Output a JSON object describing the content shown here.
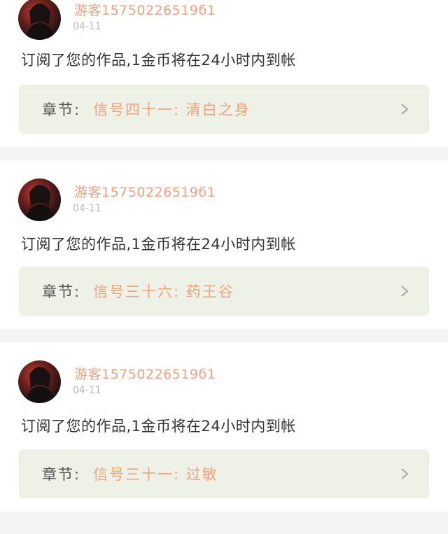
{
  "notifications": [
    {
      "username": "游客15750226519б1",
      "date": "04-11",
      "message": "订阅了您的作品,1金币将在24小时内到帐",
      "chapter_label": "章节:",
      "chapter_title": "信号四十一: 清白之身"
    },
    {
      "username": "游客15750226519б1",
      "date": "04-11",
      "message": "订阅了您的作品,1金币将在24小时内到帐",
      "chapter_label": "章节:",
      "chapter_title": "信号三十六: 药王谷"
    },
    {
      "username": "游客15750226519б1",
      "date": "04-11",
      "message": "订阅了您的作品,1金币将在24小时内到帐",
      "chapter_label": "章节:",
      "chapter_title": "信号三十一: 过敏"
    }
  ],
  "icons": {
    "avatar": "user-avatar",
    "chevron": "chevron-right-icon"
  },
  "colors": {
    "username": "#eea27f",
    "chapter_title": "#f0a27c",
    "chapter_box": "#eef1e6",
    "background": "#f4f4f4"
  }
}
